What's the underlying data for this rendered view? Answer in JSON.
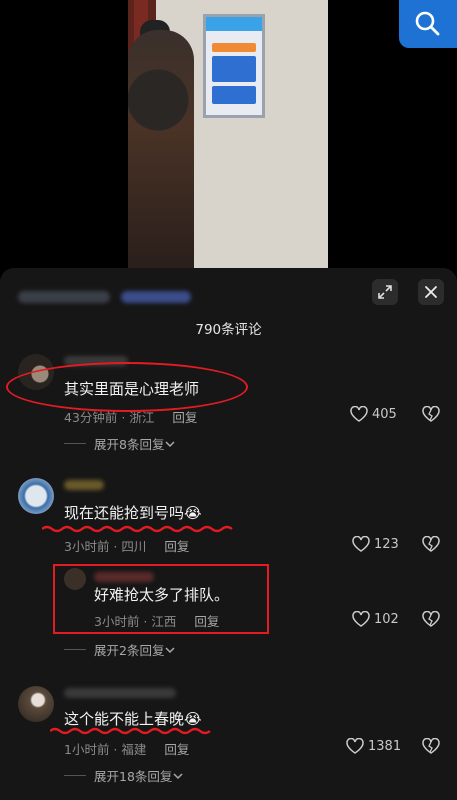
{
  "search": {
    "icon": "search-icon"
  },
  "panel": {
    "title": "790条评论",
    "expand_icon": "expand-icon",
    "close_icon": "close-icon"
  },
  "comments": [
    {
      "text": "其实里面是心理老师",
      "time_location": "43分钟前 · 浙江",
      "reply": "回复",
      "likes": "405",
      "expand": "展开8条回复"
    },
    {
      "text": "现在还能抢到号吗😭",
      "time_location": "3小时前 · 四川",
      "reply": "回复",
      "likes": "123"
    },
    {
      "text": "好难抢太多了排队。",
      "time_location": "3小时前 · 江西",
      "reply": "回复",
      "likes": "102",
      "expand": "展开2条回复"
    },
    {
      "text": "这个能不能上春晚😭",
      "time_location": "1小时前 · 福建",
      "reply": "回复",
      "likes": "1381",
      "expand": "展开18条回复"
    }
  ],
  "colors": {
    "annotation_red": "#e31b23",
    "panel_bg": "#161616"
  }
}
